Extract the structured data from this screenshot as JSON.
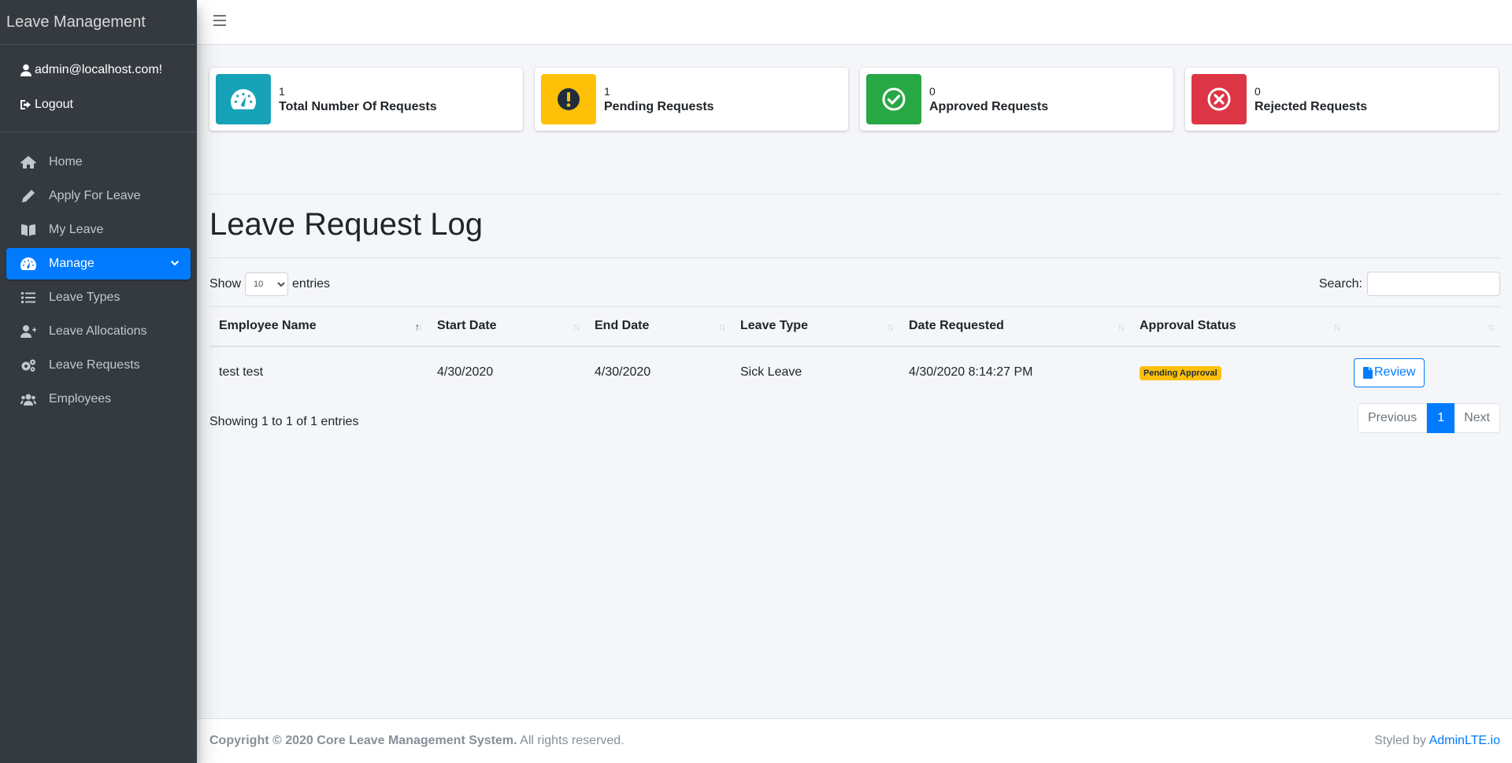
{
  "brand": "Leave Management",
  "user": {
    "email": "admin@localhost.com!",
    "logout": "Logout"
  },
  "nav": {
    "items": [
      {
        "label": "Home",
        "icon": "home-icon"
      },
      {
        "label": "Apply For Leave",
        "icon": "pencil-icon"
      },
      {
        "label": "My Leave",
        "icon": "book-icon"
      },
      {
        "label": "Manage",
        "icon": "tachometer-icon",
        "active": true
      },
      {
        "label": "Leave Types",
        "icon": "list-icon"
      },
      {
        "label": "Leave Allocations",
        "icon": "user-plus-icon"
      },
      {
        "label": "Leave Requests",
        "icon": "cogs-icon"
      },
      {
        "label": "Employees",
        "icon": "users-icon"
      }
    ]
  },
  "stats": [
    {
      "value": "1",
      "label": "Total Number Of Requests",
      "color": "#17a2b8",
      "icon": "tachometer-icon"
    },
    {
      "value": "1",
      "label": "Pending Requests",
      "color": "#ffc107",
      "icon": "exclamation-icon"
    },
    {
      "value": "0",
      "label": "Approved Requests",
      "color": "#28a745",
      "icon": "check-circle-icon"
    },
    {
      "value": "0",
      "label": "Rejected Requests",
      "color": "#dc3545",
      "icon": "times-circle-icon"
    }
  ],
  "page_title": "Leave Request Log",
  "table_controls": {
    "show": "Show",
    "entries_value": "10",
    "entries": "entries",
    "search_label": "Search:"
  },
  "table": {
    "headers": [
      "Employee Name",
      "Start Date",
      "End Date",
      "Leave Type",
      "Date Requested",
      "Approval Status",
      ""
    ],
    "rows": [
      {
        "employee": "test test",
        "start": "4/30/2020",
        "end": "4/30/2020",
        "type": "Sick Leave",
        "requested": "4/30/2020 8:14:27 PM",
        "status": "Pending Approval",
        "action": "Review"
      }
    ]
  },
  "showing": "Showing 1 to 1 of 1 entries",
  "pagination": {
    "previous": "Previous",
    "current": "1",
    "next": "Next"
  },
  "footer": {
    "copyright": "Copyright © 2020 Core Leave Management System.",
    "rights": "All rights reserved.",
    "styled_by": "Styled by",
    "link": "AdminLTE.io"
  },
  "colors": {
    "accent": "#007bff",
    "sidebar": "#343a40"
  }
}
